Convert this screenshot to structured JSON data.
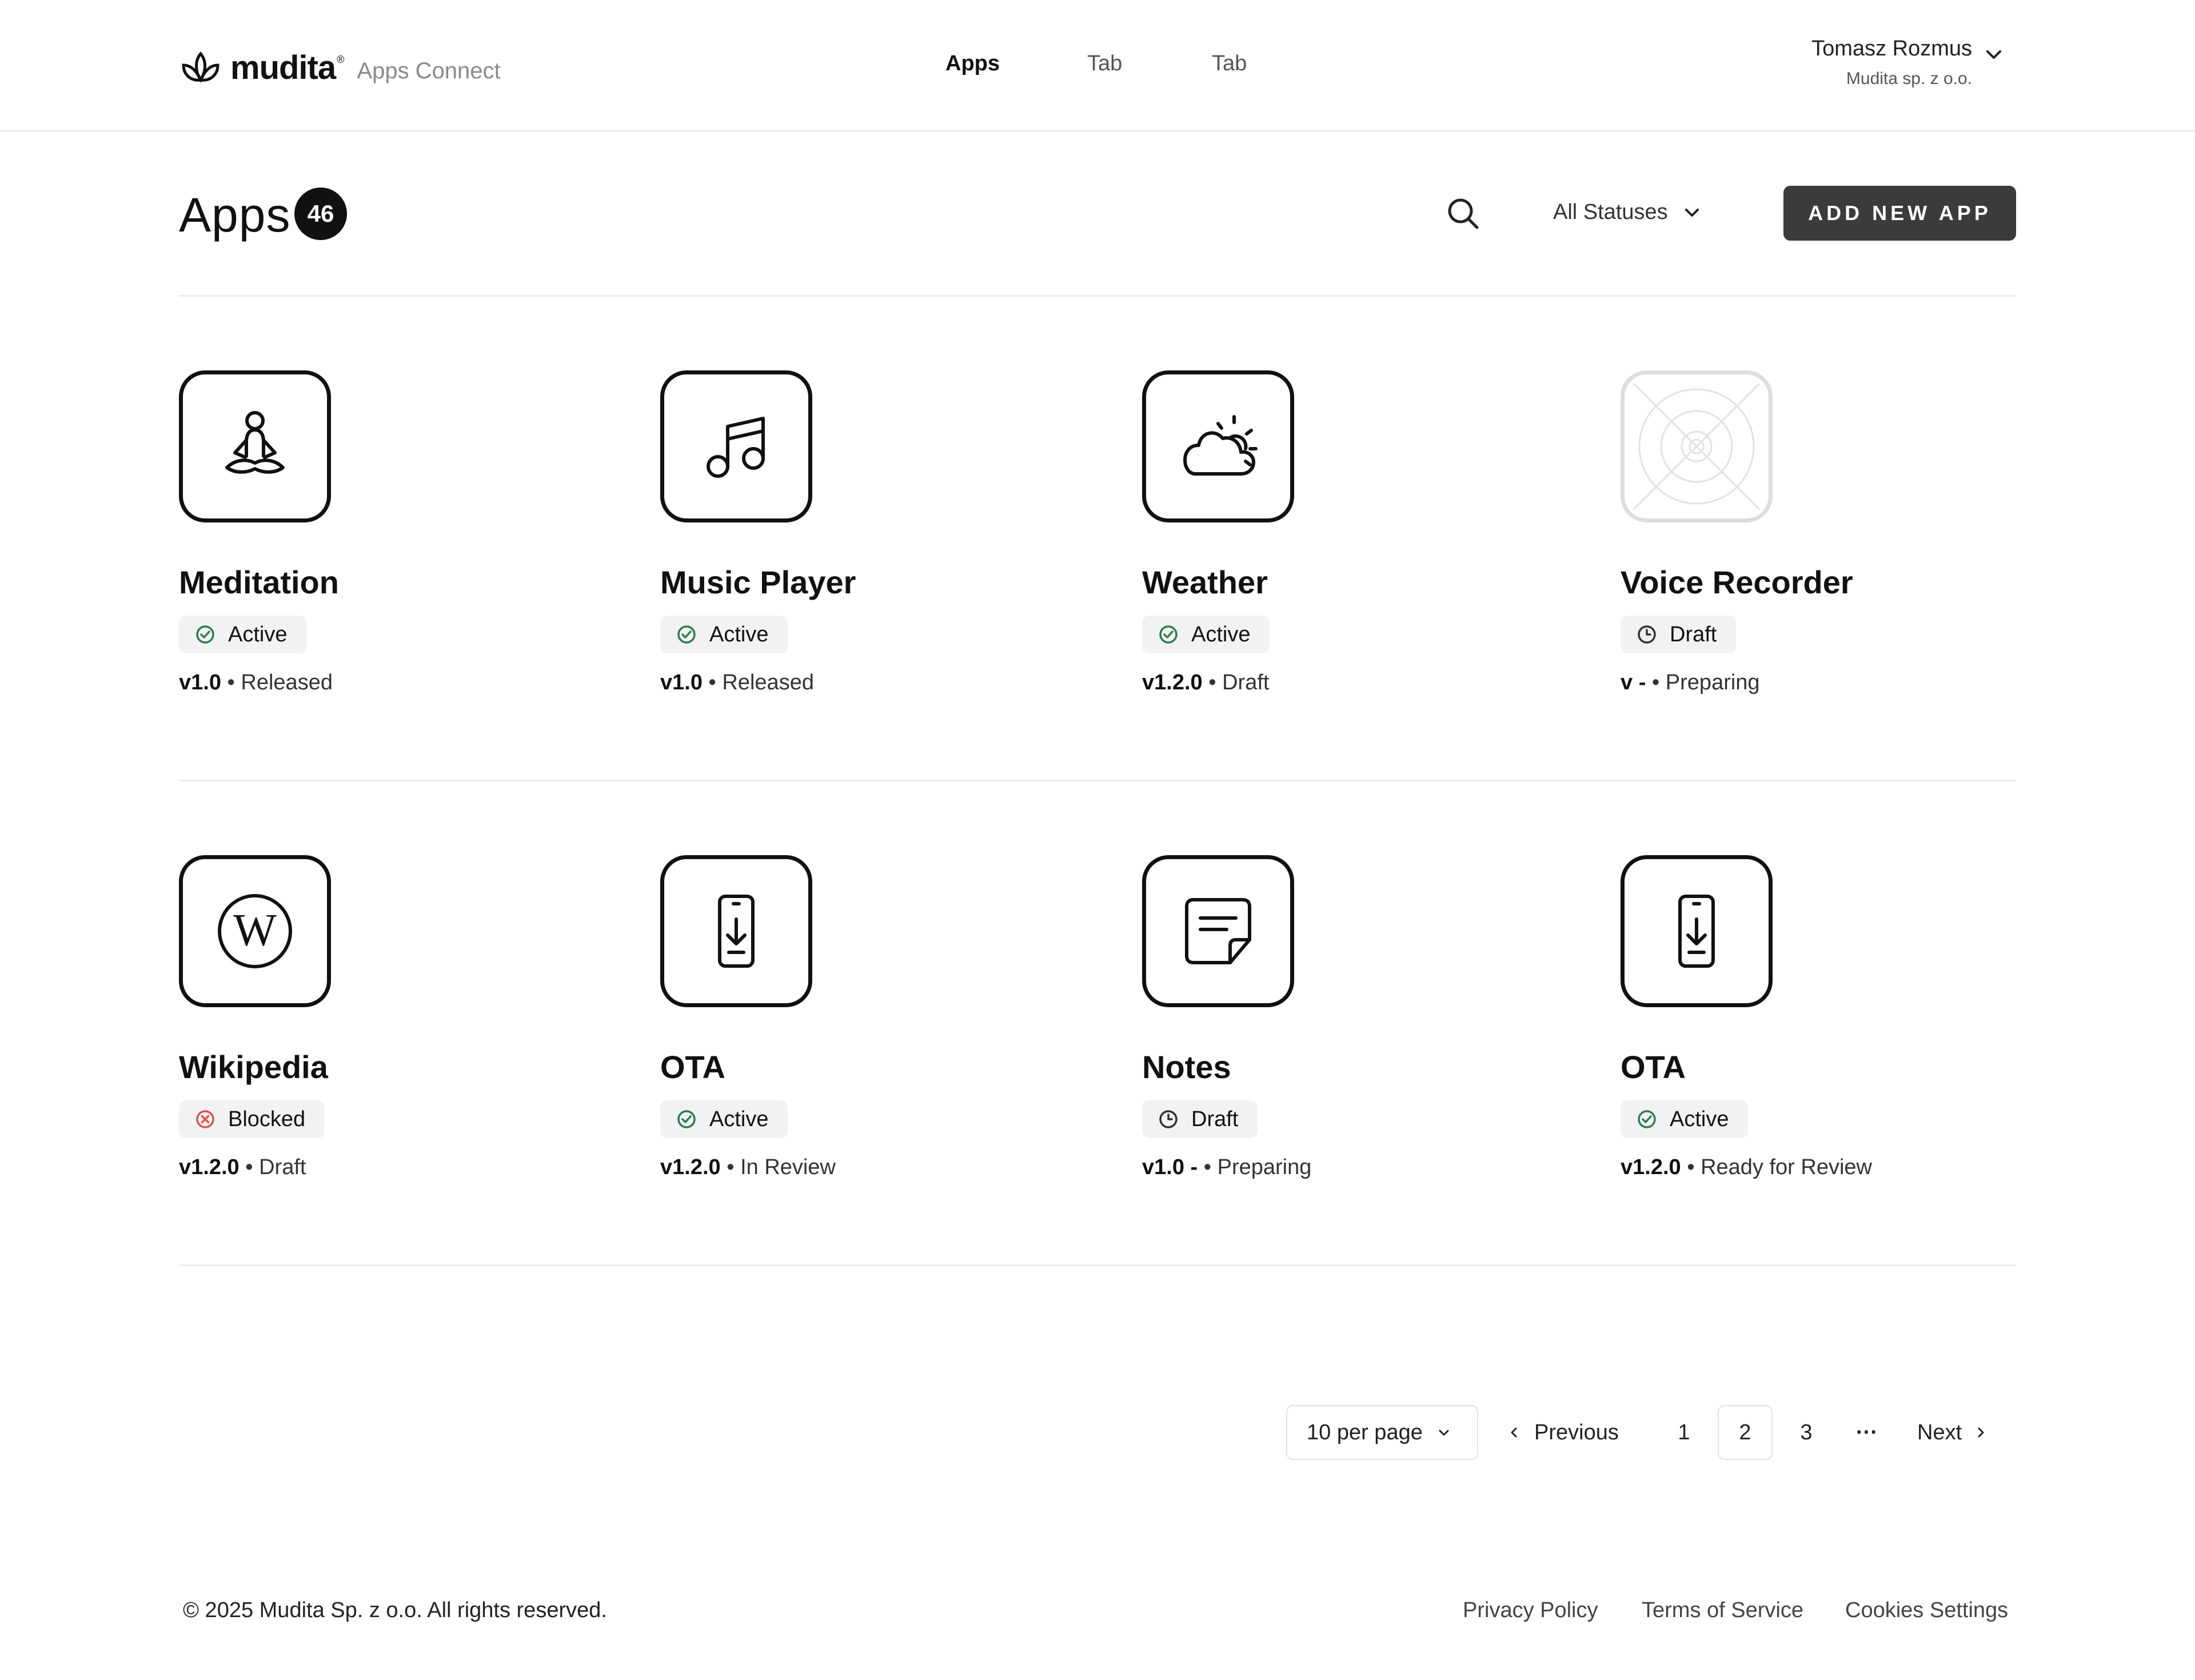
{
  "header": {
    "logo_text": "mudita",
    "logo_reg": "®",
    "logo_sub": "Apps Connect",
    "nav": [
      "Apps",
      "Tab",
      "Tab"
    ],
    "user_name": "Tomasz Rozmus",
    "user_org": "Mudita sp. z o.o."
  },
  "toolbar": {
    "title": "Apps",
    "count": "46",
    "status_filter": "All Statuses",
    "add_button": "ADD NEW APP"
  },
  "apps": [
    {
      "name": "Meditation",
      "icon": "meditation-icon",
      "status": "Active",
      "version": "v1.0",
      "stage": "Released"
    },
    {
      "name": "Music Player",
      "icon": "music-note-icon",
      "status": "Active",
      "version": "v1.0",
      "stage": "Released"
    },
    {
      "name": "Weather",
      "icon": "weather-cloud-sun-icon",
      "status": "Active",
      "version": "v1.2.0",
      "stage": "Draft"
    },
    {
      "name": "Voice Recorder",
      "icon": "placeholder-icon",
      "status": "Draft",
      "version": "v -",
      "stage": "Preparing"
    },
    {
      "name": "Wikipedia",
      "icon": "wikipedia-icon",
      "status": "Blocked",
      "version": "v1.2.0",
      "stage": "Draft"
    },
    {
      "name": "OTA",
      "icon": "phone-download-icon",
      "status": "Active",
      "version": "v1.2.0",
      "stage": "In Review"
    },
    {
      "name": "Notes",
      "icon": "note-icon",
      "status": "Draft",
      "version": "v1.0 -",
      "stage": "Preparing"
    },
    {
      "name": "OTA",
      "icon": "phone-download-icon",
      "status": "Active",
      "version": "v1.2.0",
      "stage": "Ready for Review"
    }
  ],
  "separator": "•",
  "pagination": {
    "per_page": "10 per page",
    "previous": "Previous",
    "pages": [
      "1",
      "2",
      "3"
    ],
    "current_page": "2",
    "ellipsis": "···",
    "next": "Next"
  },
  "footer": {
    "copyright": "© 2025 Mudita Sp. z o.o. All rights reserved.",
    "links": [
      "Privacy Policy",
      "Terms of Service",
      "Cookies Settings"
    ]
  },
  "colors": {
    "active": "#2e7d4f",
    "blocked": "#d9534f",
    "draft": "#333333",
    "button_bg": "#3a3b3d"
  }
}
